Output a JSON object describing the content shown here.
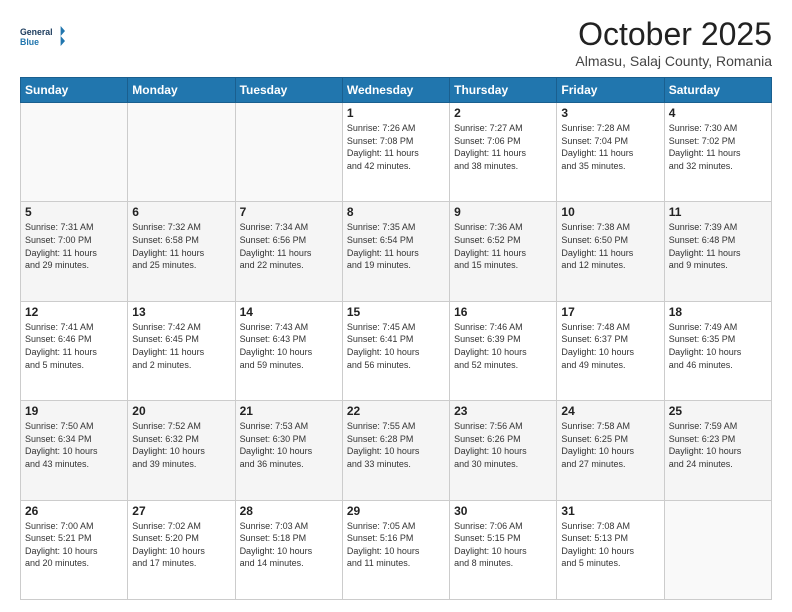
{
  "header": {
    "logo": {
      "line1": "General",
      "line2": "Blue"
    },
    "title": "October 2025",
    "subtitle": "Almasu, Salaj County, Romania"
  },
  "days_of_week": [
    "Sunday",
    "Monday",
    "Tuesday",
    "Wednesday",
    "Thursday",
    "Friday",
    "Saturday"
  ],
  "weeks": [
    [
      {
        "day": "",
        "info": ""
      },
      {
        "day": "",
        "info": ""
      },
      {
        "day": "",
        "info": ""
      },
      {
        "day": "1",
        "info": "Sunrise: 7:26 AM\nSunset: 7:08 PM\nDaylight: 11 hours\nand 42 minutes."
      },
      {
        "day": "2",
        "info": "Sunrise: 7:27 AM\nSunset: 7:06 PM\nDaylight: 11 hours\nand 38 minutes."
      },
      {
        "day": "3",
        "info": "Sunrise: 7:28 AM\nSunset: 7:04 PM\nDaylight: 11 hours\nand 35 minutes."
      },
      {
        "day": "4",
        "info": "Sunrise: 7:30 AM\nSunset: 7:02 PM\nDaylight: 11 hours\nand 32 minutes."
      }
    ],
    [
      {
        "day": "5",
        "info": "Sunrise: 7:31 AM\nSunset: 7:00 PM\nDaylight: 11 hours\nand 29 minutes."
      },
      {
        "day": "6",
        "info": "Sunrise: 7:32 AM\nSunset: 6:58 PM\nDaylight: 11 hours\nand 25 minutes."
      },
      {
        "day": "7",
        "info": "Sunrise: 7:34 AM\nSunset: 6:56 PM\nDaylight: 11 hours\nand 22 minutes."
      },
      {
        "day": "8",
        "info": "Sunrise: 7:35 AM\nSunset: 6:54 PM\nDaylight: 11 hours\nand 19 minutes."
      },
      {
        "day": "9",
        "info": "Sunrise: 7:36 AM\nSunset: 6:52 PM\nDaylight: 11 hours\nand 15 minutes."
      },
      {
        "day": "10",
        "info": "Sunrise: 7:38 AM\nSunset: 6:50 PM\nDaylight: 11 hours\nand 12 minutes."
      },
      {
        "day": "11",
        "info": "Sunrise: 7:39 AM\nSunset: 6:48 PM\nDaylight: 11 hours\nand 9 minutes."
      }
    ],
    [
      {
        "day": "12",
        "info": "Sunrise: 7:41 AM\nSunset: 6:46 PM\nDaylight: 11 hours\nand 5 minutes."
      },
      {
        "day": "13",
        "info": "Sunrise: 7:42 AM\nSunset: 6:45 PM\nDaylight: 11 hours\nand 2 minutes."
      },
      {
        "day": "14",
        "info": "Sunrise: 7:43 AM\nSunset: 6:43 PM\nDaylight: 10 hours\nand 59 minutes."
      },
      {
        "day": "15",
        "info": "Sunrise: 7:45 AM\nSunset: 6:41 PM\nDaylight: 10 hours\nand 56 minutes."
      },
      {
        "day": "16",
        "info": "Sunrise: 7:46 AM\nSunset: 6:39 PM\nDaylight: 10 hours\nand 52 minutes."
      },
      {
        "day": "17",
        "info": "Sunrise: 7:48 AM\nSunset: 6:37 PM\nDaylight: 10 hours\nand 49 minutes."
      },
      {
        "day": "18",
        "info": "Sunrise: 7:49 AM\nSunset: 6:35 PM\nDaylight: 10 hours\nand 46 minutes."
      }
    ],
    [
      {
        "day": "19",
        "info": "Sunrise: 7:50 AM\nSunset: 6:34 PM\nDaylight: 10 hours\nand 43 minutes."
      },
      {
        "day": "20",
        "info": "Sunrise: 7:52 AM\nSunset: 6:32 PM\nDaylight: 10 hours\nand 39 minutes."
      },
      {
        "day": "21",
        "info": "Sunrise: 7:53 AM\nSunset: 6:30 PM\nDaylight: 10 hours\nand 36 minutes."
      },
      {
        "day": "22",
        "info": "Sunrise: 7:55 AM\nSunset: 6:28 PM\nDaylight: 10 hours\nand 33 minutes."
      },
      {
        "day": "23",
        "info": "Sunrise: 7:56 AM\nSunset: 6:26 PM\nDaylight: 10 hours\nand 30 minutes."
      },
      {
        "day": "24",
        "info": "Sunrise: 7:58 AM\nSunset: 6:25 PM\nDaylight: 10 hours\nand 27 minutes."
      },
      {
        "day": "25",
        "info": "Sunrise: 7:59 AM\nSunset: 6:23 PM\nDaylight: 10 hours\nand 24 minutes."
      }
    ],
    [
      {
        "day": "26",
        "info": "Sunrise: 7:00 AM\nSunset: 5:21 PM\nDaylight: 10 hours\nand 20 minutes."
      },
      {
        "day": "27",
        "info": "Sunrise: 7:02 AM\nSunset: 5:20 PM\nDaylight: 10 hours\nand 17 minutes."
      },
      {
        "day": "28",
        "info": "Sunrise: 7:03 AM\nSunset: 5:18 PM\nDaylight: 10 hours\nand 14 minutes."
      },
      {
        "day": "29",
        "info": "Sunrise: 7:05 AM\nSunset: 5:16 PM\nDaylight: 10 hours\nand 11 minutes."
      },
      {
        "day": "30",
        "info": "Sunrise: 7:06 AM\nSunset: 5:15 PM\nDaylight: 10 hours\nand 8 minutes."
      },
      {
        "day": "31",
        "info": "Sunrise: 7:08 AM\nSunset: 5:13 PM\nDaylight: 10 hours\nand 5 minutes."
      },
      {
        "day": "",
        "info": ""
      }
    ]
  ]
}
